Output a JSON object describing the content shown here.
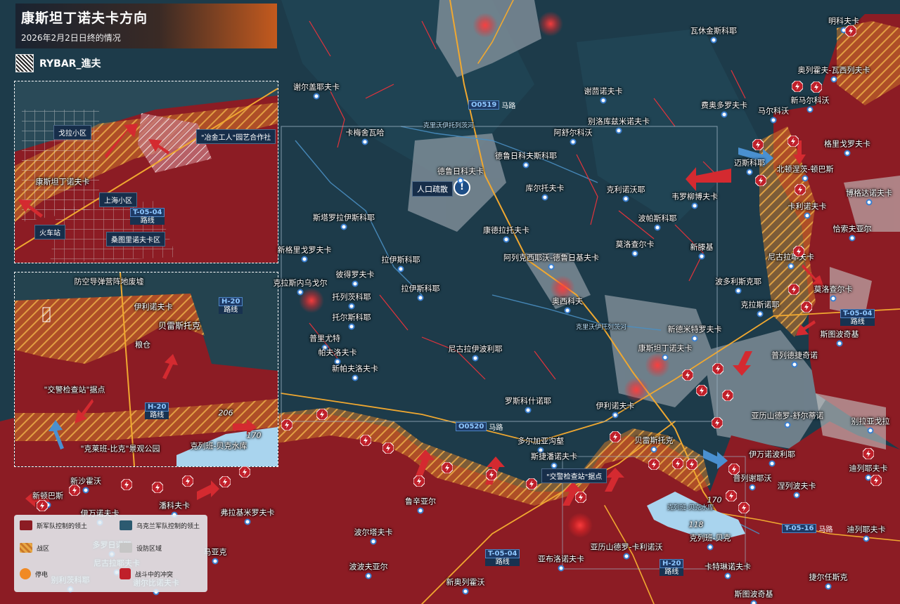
{
  "header": {
    "title": "康斯坦丁诺夫卡方向",
    "subtitle": "2026年2月2日日终的情况",
    "brand": "RYBAR_進夫"
  },
  "colors": {
    "russian_controlled": "#8c1c24",
    "ukrainian_controlled": "#1d3b4a",
    "combat_zone": "#d98a2b",
    "fortified": "#b8b8b8",
    "road_marker": "#4d86c6"
  },
  "legend": {
    "russian": "斯军队控制的领土",
    "ukrainian": "乌克兰军队控制的领土",
    "combat_zone": "战区",
    "fortified": "设防区域",
    "strike": "停电",
    "clash": "战斗中的冲突"
  },
  "notices": {
    "evacuation": "人口疏散",
    "checkpoint": "\"交警检查站\"据点"
  },
  "roads": {
    "o0519": {
      "code": "O0519",
      "suffix": "马路"
    },
    "o0520": {
      "code": "O0520",
      "suffix": "马路"
    },
    "t0504_main": {
      "code": "T-05-04",
      "suffix": "路线"
    },
    "t0504_south": {
      "code": "T-05-04",
      "suffix": "路线"
    },
    "t0516": {
      "code": "T-05-16",
      "suffix": "马路"
    },
    "h20_south": {
      "code": "H-20",
      "suffix": "路线"
    },
    "h20_inset_a": {
      "code": "H-20",
      "suffix": "路线"
    },
    "h20_inset_b": {
      "code": "H-20",
      "suffix": "路线"
    },
    "t0504_inset": {
      "code": "T-05-04",
      "suffix": "路线"
    }
  },
  "rivers": {
    "canal_north": "克里沃伊托列茨河",
    "canal_south": "克里沃伊托列茨河"
  },
  "elevations": {
    "e170": "170",
    "e118": "118",
    "e206": "206",
    "e170b": "170"
  },
  "reservoir": "克列班-贝克水库",
  "towns": [
    {
      "name": "瓦休金斯科耶"
    },
    {
      "name": "明科夫卡"
    },
    {
      "name": "奥列霍夫-瓦西列夫卡"
    },
    {
      "name": "谢尔盖耶夫卡"
    },
    {
      "name": "谢茴诺夫卡"
    },
    {
      "name": "费奥多罗夫卡"
    },
    {
      "name": "新马尔科沃"
    },
    {
      "name": "马尔科沃"
    },
    {
      "name": "别洛库兹米诺夫卡"
    },
    {
      "name": "阿舒尔科沃"
    },
    {
      "name": "卡梅舍瓦哈"
    },
    {
      "name": "格里戈罗夫卡"
    },
    {
      "name": "德鲁日科夫斯科耶"
    },
    {
      "name": "迈斯科耶"
    },
    {
      "name": "北顿涅茨-顿巴斯"
    },
    {
      "name": "德鲁日科夫卡"
    },
    {
      "name": "库尔托夫卡"
    },
    {
      "name": "克利诺沃耶"
    },
    {
      "name": "韦罗柳博夫卡"
    },
    {
      "name": "博格达诺夫卡"
    },
    {
      "name": "卡利诺夫卡"
    },
    {
      "name": "斯塔罗拉伊斯科耶"
    },
    {
      "name": "波帕斯科耶"
    },
    {
      "name": "恰索夫亚尔"
    },
    {
      "name": "康德拉托夫卡"
    },
    {
      "name": "莫洛查尔卡"
    },
    {
      "name": "新格里戈罗夫卡"
    },
    {
      "name": "新滕基"
    },
    {
      "name": "尼古拉耶夫卡"
    },
    {
      "name": "阿列克西耶沃-德鲁日基夫卡"
    },
    {
      "name": "拉伊斯科耶"
    },
    {
      "name": "克拉斯内乌戈尔"
    },
    {
      "name": "彼得罗夫卡"
    },
    {
      "name": "莫洛查尔卡"
    },
    {
      "name": "波多利斯克耶"
    },
    {
      "name": "托列茨科耶"
    },
    {
      "name": "拉伊斯科耶"
    },
    {
      "name": "克拉斯诺耶"
    },
    {
      "name": "奥西科夫"
    },
    {
      "name": "托尔斯科耶"
    },
    {
      "name": "新德米特罗夫卡"
    },
    {
      "name": "斯图波奇基"
    },
    {
      "name": "普里尤特"
    },
    {
      "name": "康斯坦丁诺夫卡"
    },
    {
      "name": "普列德捷奇诺"
    },
    {
      "name": "帕夫洛夫卡"
    },
    {
      "name": "尼古拉伊波利耶"
    },
    {
      "name": "新帕夫洛夫卡"
    },
    {
      "name": "罗斯科什诺耶"
    },
    {
      "name": "伊利诺夫卡"
    },
    {
      "name": "亚历山德罗-舒尔蒂诺"
    },
    {
      "name": "别拉亚戈拉"
    },
    {
      "name": "多尔加亚沟壑"
    },
    {
      "name": "贝雷斯托克"
    },
    {
      "name": "斯捷潘诺夫卡"
    },
    {
      "name": "伊万诺波利耶"
    },
    {
      "name": "新沙霍沃"
    },
    {
      "name": "普列谢耶沃"
    },
    {
      "name": "迪列耶夫卡"
    },
    {
      "name": "新顿巴斯"
    },
    {
      "name": "鲁辛亚尔"
    },
    {
      "name": "涅列波夫卡"
    },
    {
      "name": "伊万诺夫卡"
    },
    {
      "name": "潘科夫卡"
    },
    {
      "name": "弗拉基米罗夫卡"
    },
    {
      "name": "克列班-贝克"
    },
    {
      "name": "迪列耶夫卡"
    },
    {
      "name": "波尔塔夫卡"
    },
    {
      "name": "亚历山德罗-卡利诺沃"
    },
    {
      "name": "多罗日诺耶"
    },
    {
      "name": "马亚克"
    },
    {
      "name": "尼古拉耶夫卡"
    },
    {
      "name": "亚布洛诺夫卡"
    },
    {
      "name": "卡特琳诺夫卡"
    },
    {
      "name": "波波夫亚尔"
    },
    {
      "name": "别利茨科耶"
    },
    {
      "name": "捷尔任斯克"
    },
    {
      "name": "新奥列霍沃"
    },
    {
      "name": "谢尔比诺夫卡"
    },
    {
      "name": "斯图波奇基"
    }
  ],
  "inset_a": {
    "labels": [
      "戈拉小区",
      "\"冶金工人\"园艺合作社",
      "康斯坦丁诺夫卡",
      "上海小区",
      "火车站",
      "桑图里诺夫卡区"
    ]
  },
  "inset_b": {
    "labels": [
      "防空导弹营阵地废墟",
      "伊利诺夫卡",
      "贝雷斯托克",
      "粮仓",
      "\"交警检查站\"据点",
      "\"克莱班-比克\"景观公园",
      "克列班-贝克水库"
    ]
  }
}
